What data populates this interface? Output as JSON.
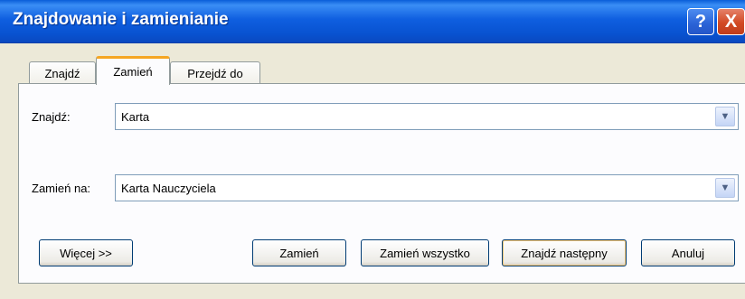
{
  "window": {
    "title": "Znajdowanie i zamienianie",
    "help_label": "?",
    "close_label": "X"
  },
  "tabs": [
    {
      "label": "Znajdź",
      "active": false
    },
    {
      "label": "Zamień",
      "active": true
    },
    {
      "label": "Przejdź do",
      "active": false
    }
  ],
  "find": {
    "label": "Znajdź:",
    "value": "Karta"
  },
  "replace": {
    "label": "Zamień na:",
    "value": "Karta Nauczyciela"
  },
  "buttons": {
    "more": "Więcej >>",
    "replace": "Zamień",
    "replace_all": "Zamień wszystko",
    "find_next": "Znajdź następny",
    "cancel": "Anuluj"
  },
  "icons": {
    "dropdown": "chevron-down-icon"
  },
  "colors": {
    "titlebar": "#0a5ed8",
    "active_tab_accent": "#f5a623",
    "dialog_bg": "#ece9d8"
  }
}
